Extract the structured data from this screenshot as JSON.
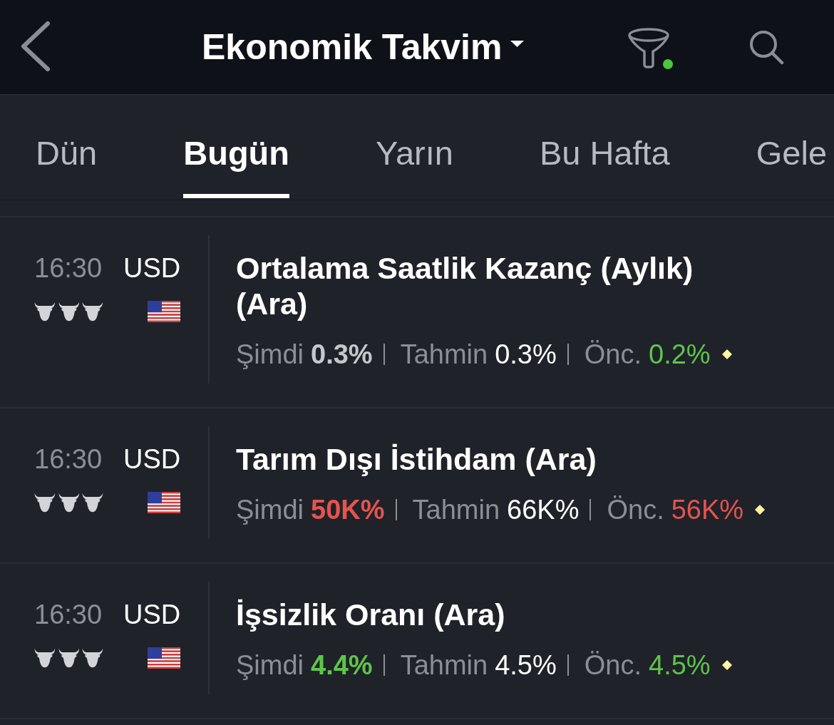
{
  "header": {
    "title": "Ekonomik Takvim",
    "filter_active": true
  },
  "tabs": [
    {
      "label": "Dün",
      "selected": false
    },
    {
      "label": "Bugün",
      "selected": true
    },
    {
      "label": "Yarın",
      "selected": false
    },
    {
      "label": "Bu Hafta",
      "selected": false
    },
    {
      "label": "Gele",
      "selected": false
    }
  ],
  "events": [
    {
      "time": "16:30",
      "currency": "USD",
      "stars": 3,
      "title": "Ortalama Saatlik Kazanç (Aylık) (Ara)",
      "actual": {
        "label": "Şimdi",
        "value": "0.3%",
        "color": "#c6c7cb"
      },
      "forecast": {
        "label": "Tahmin",
        "value": "0.3%"
      },
      "previous": {
        "label": "Önc.",
        "value": "0.2%",
        "color": "#5ec44a",
        "revised": true
      }
    },
    {
      "time": "16:30",
      "currency": "USD",
      "stars": 3,
      "title": "Tarım Dışı İstihdam (Ara)",
      "actual": {
        "label": "Şimdi",
        "value": "50K%",
        "color": "#e5544e"
      },
      "forecast": {
        "label": "Tahmin",
        "value": "66K%"
      },
      "previous": {
        "label": "Önc.",
        "value": "56K%",
        "color": "#e5544e",
        "revised": true
      }
    },
    {
      "time": "16:30",
      "currency": "USD",
      "stars": 3,
      "title": "İşsizlik Oranı (Ara)",
      "actual": {
        "label": "Şimdi",
        "value": "4.4%",
        "color": "#5ec44a"
      },
      "forecast": {
        "label": "Tahmin",
        "value": "4.5%"
      },
      "previous": {
        "label": "Önc.",
        "value": "4.5%",
        "color": "#5ec44a",
        "revised": true
      }
    }
  ]
}
